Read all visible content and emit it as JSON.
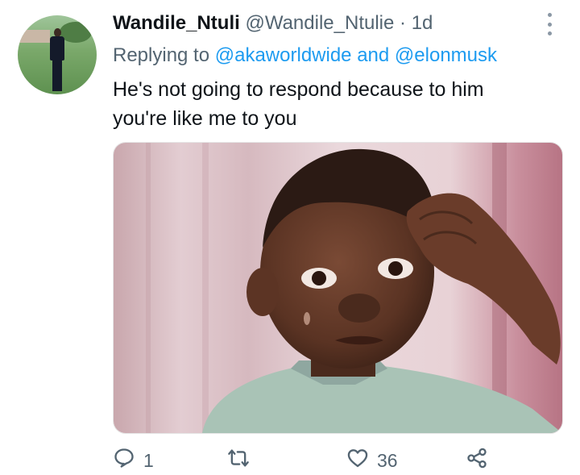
{
  "tweet": {
    "author_name": "Wandile_Ntuli",
    "author_handle": "@Wandile_Ntulie",
    "dot": "·",
    "time": "1d",
    "replying_prefix": "Replying to",
    "replying_user1": "@akaworldwide",
    "replying_and": "and",
    "replying_user2": "@elonmusk",
    "text_line1": "He's not going to respond because to him",
    "text_line2": "you're like me to you",
    "media_description_icon": "meme-photo-child-saluting"
  },
  "actions": {
    "reply_count": "1",
    "retweet_count": "",
    "like_count": "36",
    "reply_icon": "comment-icon",
    "retweet_icon": "retweet-icon",
    "like_icon": "heart-icon",
    "share_icon": "share-icon"
  },
  "colors": {
    "link": "#1d9bf0",
    "muted": "#536471",
    "text": "#0f1419"
  }
}
